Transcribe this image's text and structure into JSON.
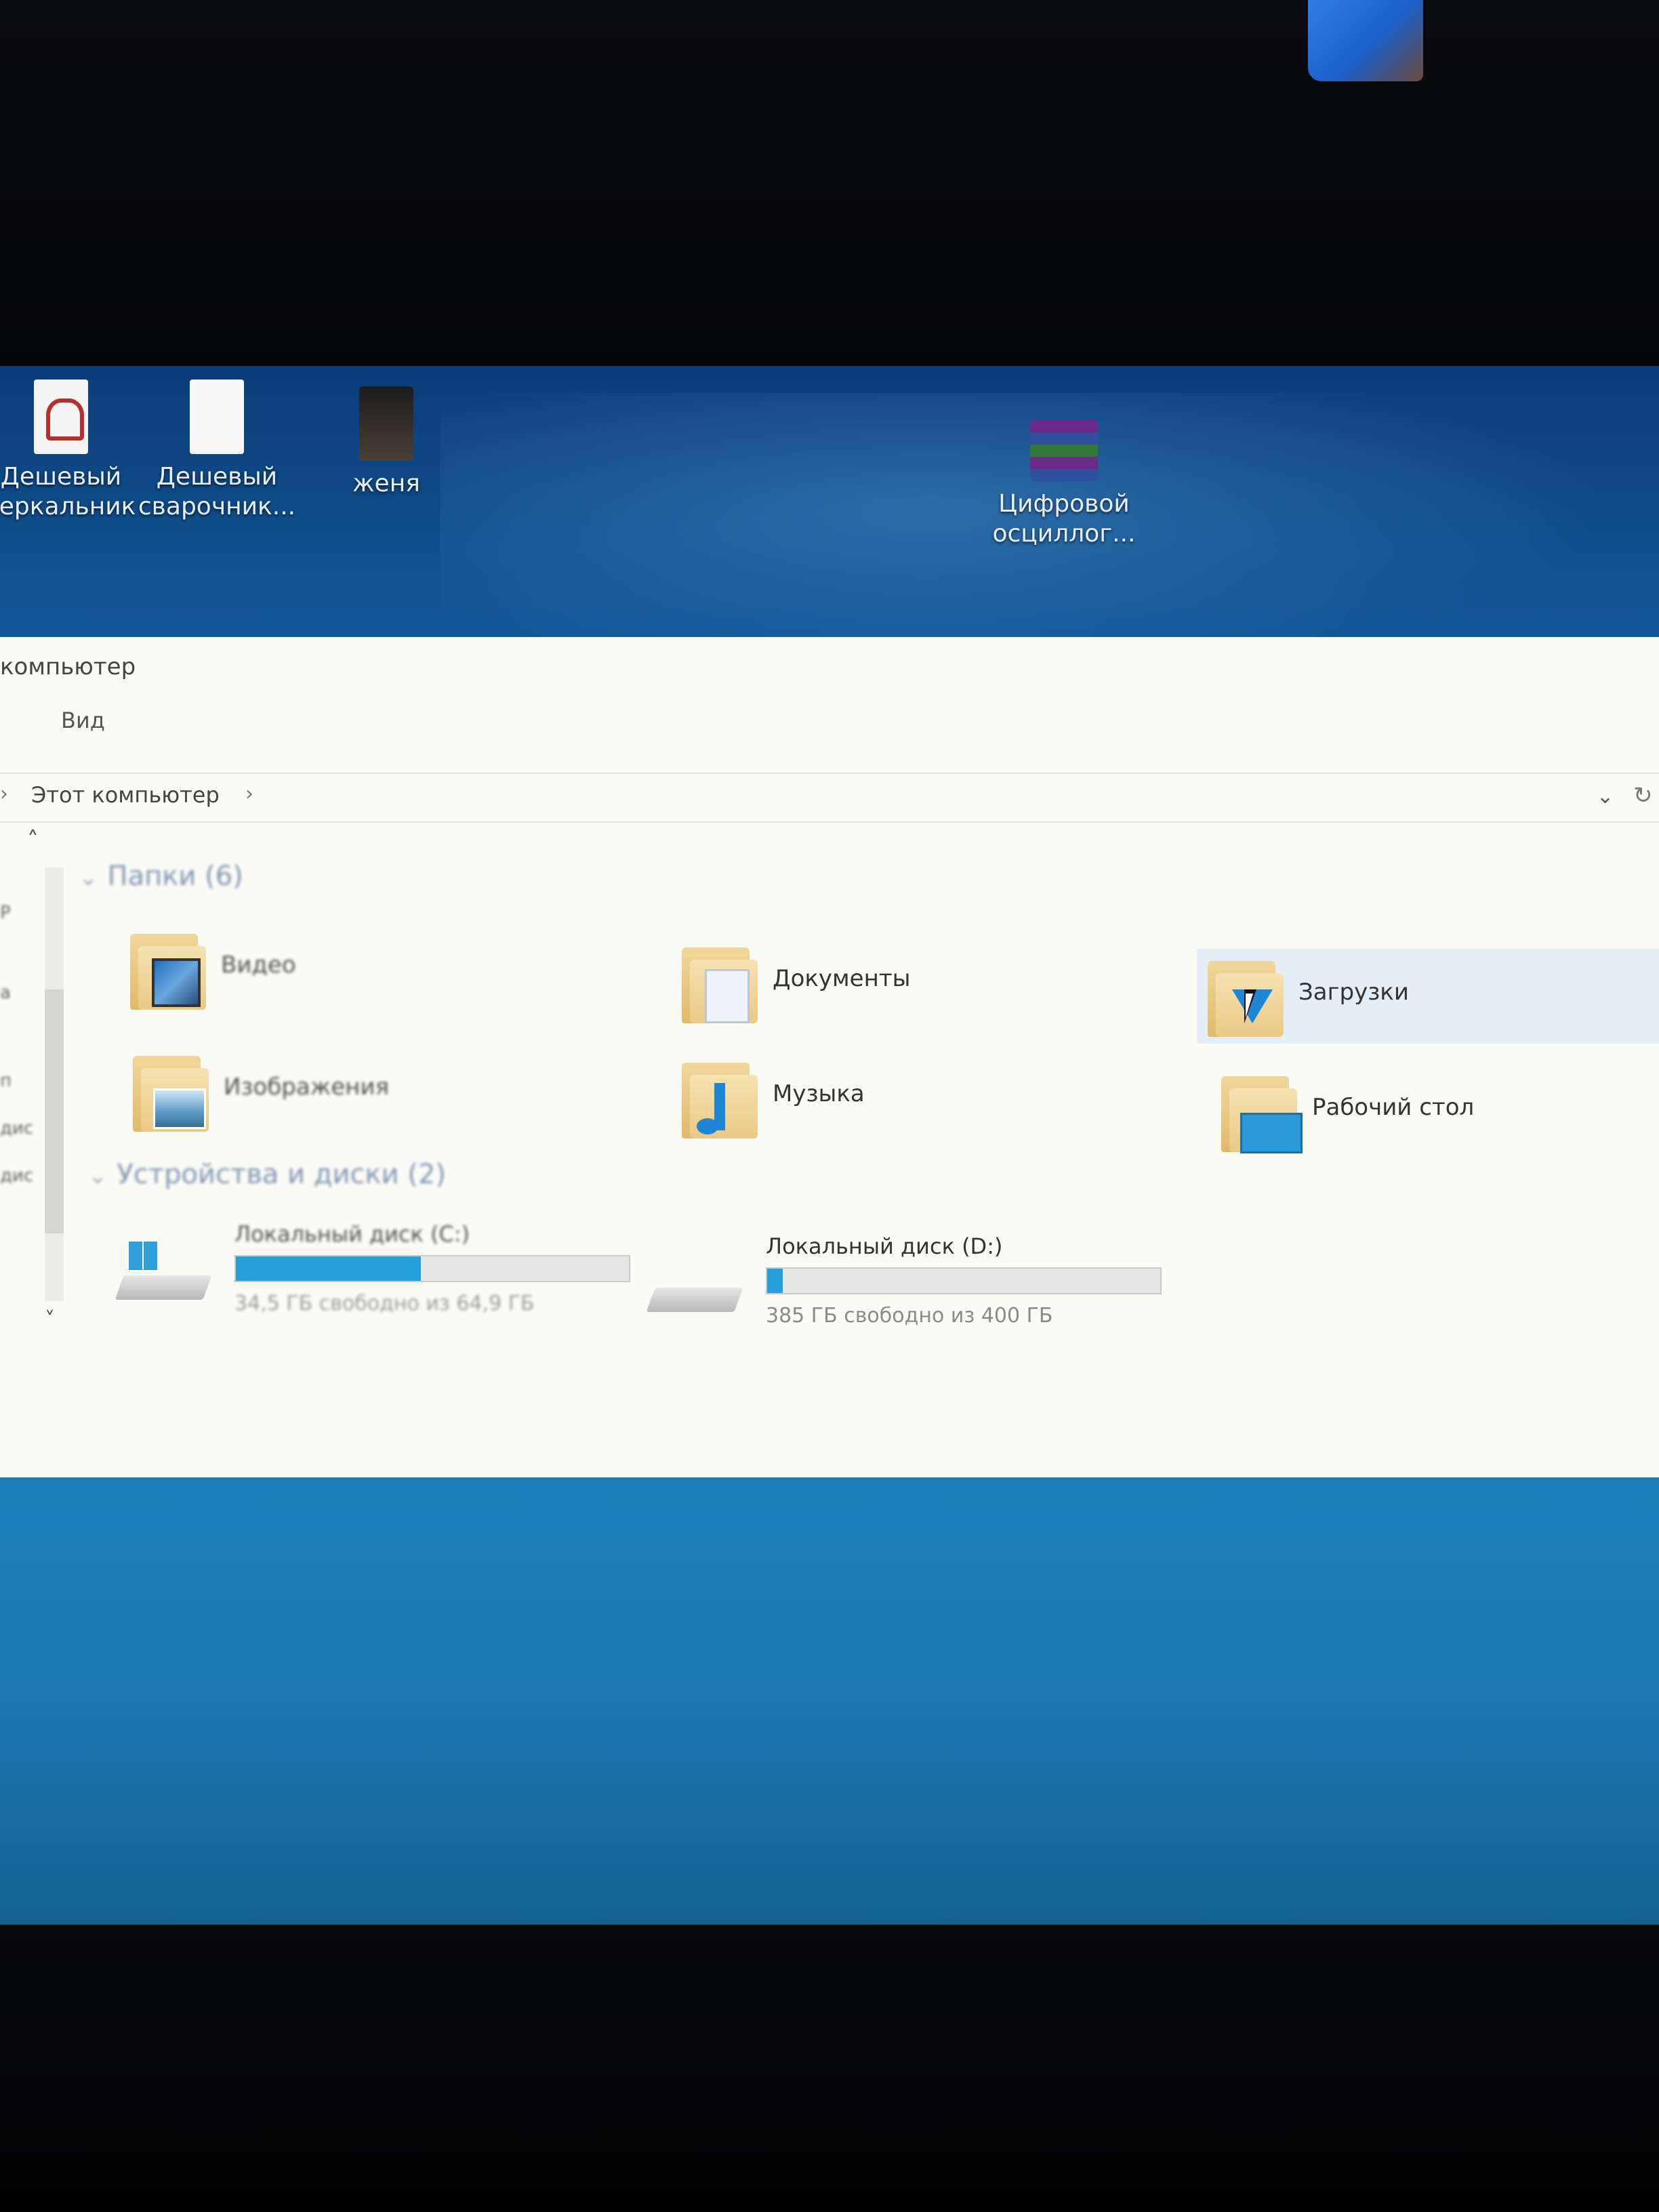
{
  "desktop": {
    "icons": [
      {
        "label": "Дешевый зеркальник",
        "icon": "pdf-icon"
      },
      {
        "label": "Дешевый сварочник...",
        "icon": "document-icon"
      },
      {
        "label": "женя",
        "icon": "photo-icon"
      },
      {
        "label": "Цифровой осциллог...",
        "icon": "winrar-archive-icon"
      }
    ]
  },
  "explorer": {
    "window_title": "компьютер",
    "ribbon": {
      "view_tab": "Вид"
    },
    "address": {
      "crumb": "Этот компьютер",
      "separator": "›",
      "dropdown": "⌄",
      "refresh": "↻"
    },
    "nav": {
      "up": "˄",
      "down": "˅",
      "labels": [
        "Р",
        "а",
        "п",
        "дис",
        "дис"
      ]
    },
    "folders_section": "Папки (6)",
    "folders": [
      {
        "label": "Видео",
        "icon": "video-folder-icon"
      },
      {
        "label": "Документы",
        "icon": "documents-folder-icon"
      },
      {
        "label": "Загрузки",
        "icon": "downloads-folder-icon"
      },
      {
        "label": "Изображения",
        "icon": "pictures-folder-icon"
      },
      {
        "label": "Музыка",
        "icon": "music-folder-icon"
      },
      {
        "label": "Рабочий стол",
        "icon": "desktop-folder-icon"
      }
    ],
    "drives_section": "Устройства и диски (2)",
    "drives": [
      {
        "name": "Локальный диск (C:)",
        "free_text": "34,5 ГБ свободно из 64,9 ГБ",
        "used_fraction": 0.47
      },
      {
        "name": "Локальный диск (D:)",
        "free_text": "385 ГБ свободно из 400 ГБ",
        "used_fraction": 0.04
      }
    ]
  },
  "colors": {
    "accent": "#26a0da",
    "hover": "#e4eef7"
  }
}
